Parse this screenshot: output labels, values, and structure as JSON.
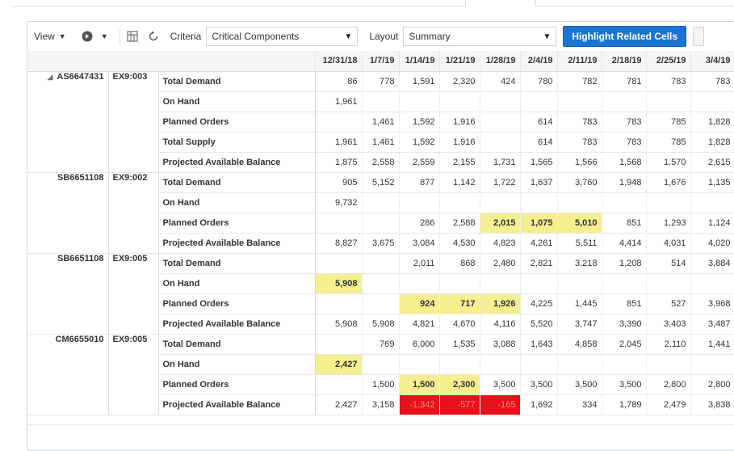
{
  "toolbar": {
    "view_label": "View",
    "criteria_label": "Criteria",
    "criteria_value": "Critical Components",
    "layout_label": "Layout",
    "layout_value": "Summary",
    "highlight_button": "Highlight Related Cells",
    "accent": "#1a75d2"
  },
  "grid": {
    "dates": [
      "12/31/18",
      "1/7/19",
      "1/14/19",
      "1/21/19",
      "1/28/19",
      "2/4/19",
      "2/11/19",
      "2/18/19",
      "2/25/19",
      "3/4/19"
    ],
    "groups": [
      {
        "item": "AS6647431",
        "org": "EX9:003",
        "expand_icon": "triangle-down-icon",
        "rows": [
          {
            "label": "Total Demand",
            "cells": [
              {
                "v": "86"
              },
              {
                "v": "778"
              },
              {
                "v": "1,591"
              },
              {
                "v": "2,320"
              },
              {
                "v": "424"
              },
              {
                "v": "780"
              },
              {
                "v": "782"
              },
              {
                "v": "781"
              },
              {
                "v": "783"
              },
              {
                "v": "783"
              }
            ]
          },
          {
            "label": "On Hand",
            "cells": [
              {
                "v": "1,961"
              },
              {
                "v": ""
              },
              {
                "v": ""
              },
              {
                "v": ""
              },
              {
                "v": ""
              },
              {
                "v": ""
              },
              {
                "v": ""
              },
              {
                "v": ""
              },
              {
                "v": ""
              },
              {
                "v": ""
              }
            ]
          },
          {
            "label": "Planned Orders",
            "cells": [
              {
                "v": ""
              },
              {
                "v": "1,461"
              },
              {
                "v": "1,592"
              },
              {
                "v": "1,916"
              },
              {
                "v": ""
              },
              {
                "v": "614"
              },
              {
                "v": "783"
              },
              {
                "v": "783"
              },
              {
                "v": "785"
              },
              {
                "v": "1,828"
              }
            ]
          },
          {
            "label": "Total Supply",
            "cells": [
              {
                "v": "1,961"
              },
              {
                "v": "1,461"
              },
              {
                "v": "1,592"
              },
              {
                "v": "1,916"
              },
              {
                "v": ""
              },
              {
                "v": "614"
              },
              {
                "v": "783"
              },
              {
                "v": "783"
              },
              {
                "v": "785"
              },
              {
                "v": "1,828"
              }
            ]
          },
          {
            "label": "Projected Available Balance",
            "cells": [
              {
                "v": "1,875"
              },
              {
                "v": "2,558"
              },
              {
                "v": "2,559"
              },
              {
                "v": "2,155"
              },
              {
                "v": "1,731"
              },
              {
                "v": "1,565"
              },
              {
                "v": "1,566"
              },
              {
                "v": "1,568"
              },
              {
                "v": "1,570"
              },
              {
                "v": "2,615"
              }
            ]
          }
        ]
      },
      {
        "item": "SB6651108",
        "org": "EX9:002",
        "expand_icon": "",
        "rows": [
          {
            "label": "Total Demand",
            "cells": [
              {
                "v": "905"
              },
              {
                "v": "5,152"
              },
              {
                "v": "877"
              },
              {
                "v": "1,142"
              },
              {
                "v": "1,722"
              },
              {
                "v": "1,637"
              },
              {
                "v": "3,760"
              },
              {
                "v": "1,948"
              },
              {
                "v": "1,676"
              },
              {
                "v": "1,135"
              }
            ]
          },
          {
            "label": "On Hand",
            "cells": [
              {
                "v": "9,732"
              },
              {
                "v": ""
              },
              {
                "v": ""
              },
              {
                "v": ""
              },
              {
                "v": ""
              },
              {
                "v": ""
              },
              {
                "v": ""
              },
              {
                "v": ""
              },
              {
                "v": ""
              },
              {
                "v": ""
              }
            ]
          },
          {
            "label": "Planned Orders",
            "cells": [
              {
                "v": ""
              },
              {
                "v": ""
              },
              {
                "v": "286"
              },
              {
                "v": "2,588"
              },
              {
                "v": "2,015",
                "s": "hl"
              },
              {
                "v": "1,075",
                "s": "hl"
              },
              {
                "v": "5,010",
                "s": "hl"
              },
              {
                "v": "851"
              },
              {
                "v": "1,293"
              },
              {
                "v": "1,124"
              }
            ]
          },
          {
            "label": "Projected Available Balance",
            "cells": [
              {
                "v": "8,827"
              },
              {
                "v": "3,675"
              },
              {
                "v": "3,084"
              },
              {
                "v": "4,530"
              },
              {
                "v": "4,823"
              },
              {
                "v": "4,261"
              },
              {
                "v": "5,511"
              },
              {
                "v": "4,414"
              },
              {
                "v": "4,031"
              },
              {
                "v": "4,020"
              }
            ]
          }
        ]
      },
      {
        "item": "SB6651108",
        "org": "EX9:005",
        "expand_icon": "",
        "rows": [
          {
            "label": "Total Demand",
            "cells": [
              {
                "v": ""
              },
              {
                "v": ""
              },
              {
                "v": "2,011"
              },
              {
                "v": "868"
              },
              {
                "v": "2,480"
              },
              {
                "v": "2,821"
              },
              {
                "v": "3,218"
              },
              {
                "v": "1,208"
              },
              {
                "v": "514"
              },
              {
                "v": "3,884"
              }
            ]
          },
          {
            "label": "On Hand",
            "cells": [
              {
                "v": "5,908",
                "s": "hl"
              },
              {
                "v": ""
              },
              {
                "v": ""
              },
              {
                "v": ""
              },
              {
                "v": ""
              },
              {
                "v": ""
              },
              {
                "v": ""
              },
              {
                "v": ""
              },
              {
                "v": ""
              },
              {
                "v": ""
              }
            ]
          },
          {
            "label": "Planned Orders",
            "cells": [
              {
                "v": ""
              },
              {
                "v": ""
              },
              {
                "v": "924",
                "s": "hl"
              },
              {
                "v": "717",
                "s": "hl"
              },
              {
                "v": "1,926",
                "s": "hl"
              },
              {
                "v": "4,225"
              },
              {
                "v": "1,445"
              },
              {
                "v": "851"
              },
              {
                "v": "527"
              },
              {
                "v": "3,968"
              }
            ]
          },
          {
            "label": "Projected Available Balance",
            "cells": [
              {
                "v": "5,908"
              },
              {
                "v": "5,908"
              },
              {
                "v": "4,821"
              },
              {
                "v": "4,670"
              },
              {
                "v": "4,116"
              },
              {
                "v": "5,520"
              },
              {
                "v": "3,747"
              },
              {
                "v": "3,390"
              },
              {
                "v": "3,403"
              },
              {
                "v": "3,487"
              }
            ]
          }
        ]
      },
      {
        "item": "CM6655010",
        "org": "EX9:005",
        "expand_icon": "",
        "rows": [
          {
            "label": "Total Demand",
            "cells": [
              {
                "v": ""
              },
              {
                "v": "769"
              },
              {
                "v": "6,000"
              },
              {
                "v": "1,535"
              },
              {
                "v": "3,088"
              },
              {
                "v": "1,643"
              },
              {
                "v": "4,858"
              },
              {
                "v": "2,045"
              },
              {
                "v": "2,110"
              },
              {
                "v": "1,441"
              }
            ]
          },
          {
            "label": "On Hand",
            "cells": [
              {
                "v": "2,427",
                "s": "hl"
              },
              {
                "v": ""
              },
              {
                "v": ""
              },
              {
                "v": ""
              },
              {
                "v": ""
              },
              {
                "v": ""
              },
              {
                "v": ""
              },
              {
                "v": ""
              },
              {
                "v": ""
              },
              {
                "v": ""
              }
            ]
          },
          {
            "label": "Planned Orders",
            "cells": [
              {
                "v": ""
              },
              {
                "v": "1,500"
              },
              {
                "v": "1,500",
                "s": "hl"
              },
              {
                "v": "2,300",
                "s": "hl"
              },
              {
                "v": "3,500"
              },
              {
                "v": "3,500"
              },
              {
                "v": "3,500"
              },
              {
                "v": "3,500"
              },
              {
                "v": "2,800"
              },
              {
                "v": "2,800"
              }
            ]
          },
          {
            "label": "Projected Available Balance",
            "cells": [
              {
                "v": "2,427"
              },
              {
                "v": "3,158"
              },
              {
                "v": "-1,342",
                "s": "neg"
              },
              {
                "v": "-577",
                "s": "neg"
              },
              {
                "v": "-165",
                "s": "neg"
              },
              {
                "v": "1,692"
              },
              {
                "v": "334"
              },
              {
                "v": "1,789"
              },
              {
                "v": "2,479"
              },
              {
                "v": "3,838"
              }
            ]
          }
        ]
      }
    ],
    "colors": {
      "highlight": "#f5ef90",
      "negative": "#e8101a",
      "header_bg": "#f5f5f5"
    }
  }
}
